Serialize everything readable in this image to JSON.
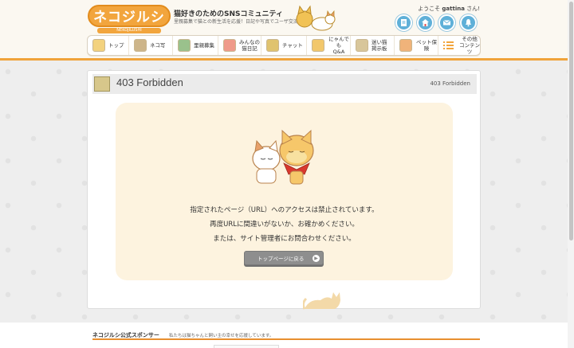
{
  "header": {
    "logo": "ネコジルシ",
    "logo_sub": "NEKOJILUSHI",
    "tagline": "猫好きのためのSNSコミュニティ",
    "subline": "里親募集で猫との新生活を応援！日記や写真でユーザ交流",
    "welcome_prefix": "ようこそ",
    "username": "gattina",
    "welcome_suffix": "さん!"
  },
  "nav": {
    "items": [
      {
        "label": "トップ",
        "color": "#f3d27e"
      },
      {
        "label": "ネコ写",
        "color": "#cdb58a"
      },
      {
        "label": "里親募集",
        "color": "#9ac18c"
      },
      {
        "label": "みんなの\n猫日記",
        "color": "#ef9a8a"
      },
      {
        "label": "チャット",
        "color": "#e0c36f"
      },
      {
        "label": "にゃんでも\nQ&A",
        "color": "#f2c76b"
      },
      {
        "label": "迷い猫\n掲示板",
        "color": "#d8c69a"
      },
      {
        "label": "ペット保険",
        "color": "#f0b37a"
      },
      {
        "label": "その他\nコンテンツ",
        "color": "#f2a53d"
      }
    ]
  },
  "page": {
    "title": "403 Forbidden",
    "crumb": "403 Forbidden"
  },
  "message": {
    "line1": "指定されたページ（URL）へのアクセスは禁止されています。",
    "line2": "再度URLに間違いがないか、お確かめください。",
    "line3": "または、サイト管理者にお問合わせください。",
    "button": "トップページに戻る"
  },
  "footer": {
    "sponsor": "ネコジルシ公式スポンサー",
    "sponsor_sub": "私たちは猫ちゃんと飼い主の幸せを応援しています。"
  },
  "colors": {
    "accent": "#f0a33a",
    "icon_blue": "#5fb0d8",
    "message_bg": "#fdf3df",
    "button": "#8e8e8e"
  }
}
